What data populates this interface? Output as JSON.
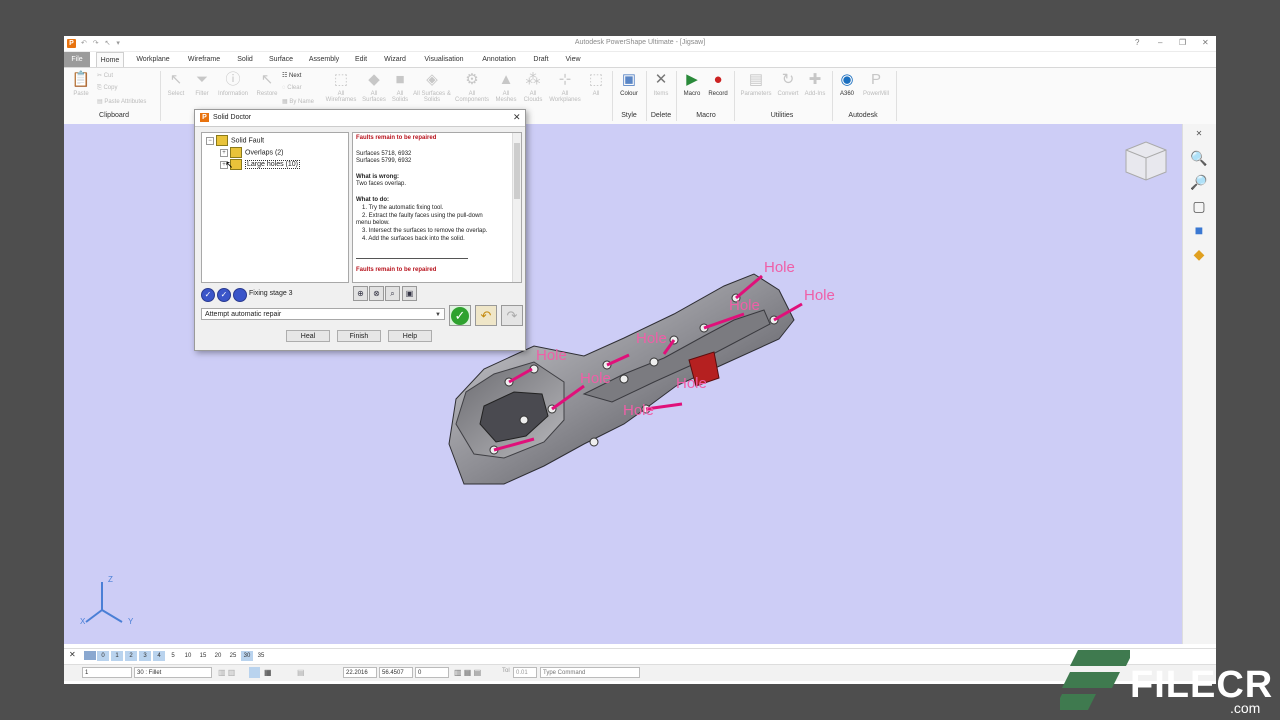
{
  "window": {
    "title": "Autodesk PowerShape Ultimate - [Jigsaw]",
    "help_icon": "?",
    "min_icon": "–",
    "restore_icon": "❐",
    "close_icon": "✕"
  },
  "tabs": [
    "File",
    "Home",
    "Workplane",
    "Wireframe",
    "Solid",
    "Surface",
    "Assembly",
    "Edit",
    "Wizard",
    "Visualisation",
    "Annotation",
    "Draft",
    "View"
  ],
  "active_tab": "Home",
  "ribbon": {
    "clipboard": {
      "paste": "Paste",
      "cut": "Cut",
      "copy": "Copy",
      "paste_attributes": "Paste Attributes",
      "group": "Clipboard"
    },
    "select": [
      "Select",
      "Filter",
      "Information",
      "Restore"
    ],
    "small": {
      "next": "Next",
      "clear": "Clear",
      "by_name": "By Name"
    },
    "all_items": [
      "All Wireframes",
      "All Surfaces",
      "All Solids",
      "All Surfaces & Solids",
      "All Components",
      "All Meshes",
      "All Clouds",
      "All Workplanes",
      "All"
    ],
    "style": {
      "colour": "Colour",
      "group": "Style"
    },
    "delete": {
      "items": "Items",
      "group": "Delete"
    },
    "macro": {
      "macro": "Macro",
      "record": "Record",
      "group": "Macro"
    },
    "utilities": {
      "parameters": "Parameters",
      "convert": "Convert",
      "addins": "Add-Ins",
      "group": "Utilities"
    },
    "autodesk": {
      "a360": "A360",
      "powermill": "PowerMill",
      "group": "Autodesk"
    }
  },
  "dialog": {
    "title": "Solid Doctor",
    "tree": {
      "root": "Solid Fault",
      "children": [
        "Overlaps (2)",
        "Large holes (10)"
      ]
    },
    "info": {
      "heading": "Faults remain to be repaired",
      "line1": "Surfaces 5718, 6932",
      "line2": "Surfaces 5799, 6932",
      "what_wrong": "What is wrong:",
      "wrong_text": "Two faces overlap.",
      "what_do": "What to do:",
      "steps": [
        "1. Try the automatic fixing tool.",
        "2. Extract the faulty faces using the pull-down",
        "menu below.",
        "3. Intersect the surfaces to remove the overlap.",
        "4. Add the surfaces back into the solid."
      ],
      "heading2": "Faults remain to be repaired"
    },
    "stage": "Fixing stage 3",
    "combo": "Attempt automatic repair",
    "buttons": {
      "heal": "Heal",
      "finish": "Finish",
      "help": "Help"
    }
  },
  "viewport": {
    "labels": [
      "Hole",
      "Hole",
      "Hole",
      "Hole",
      "Hole",
      "Hole",
      "Hole",
      "Hole"
    ],
    "axis": {
      "z": "Z",
      "x": "X",
      "y": "Y"
    },
    "background": "#cdcdf6",
    "label_color": "#ef5fa7",
    "pin_color": "#e0107a"
  },
  "levels": [
    "0",
    "1",
    "2",
    "3",
    "4",
    "5",
    "10",
    "15",
    "20",
    "25",
    "30",
    "35"
  ],
  "status": {
    "level_value": "1",
    "level_name": "30 : Fillet",
    "x": "22.2016",
    "y": "56.4507",
    "z": "0",
    "tol_label": "Tol",
    "tol": "0.01",
    "command_placeholder": "Type Command"
  },
  "watermark": {
    "brand": "FILECR",
    "domain": ".com"
  }
}
